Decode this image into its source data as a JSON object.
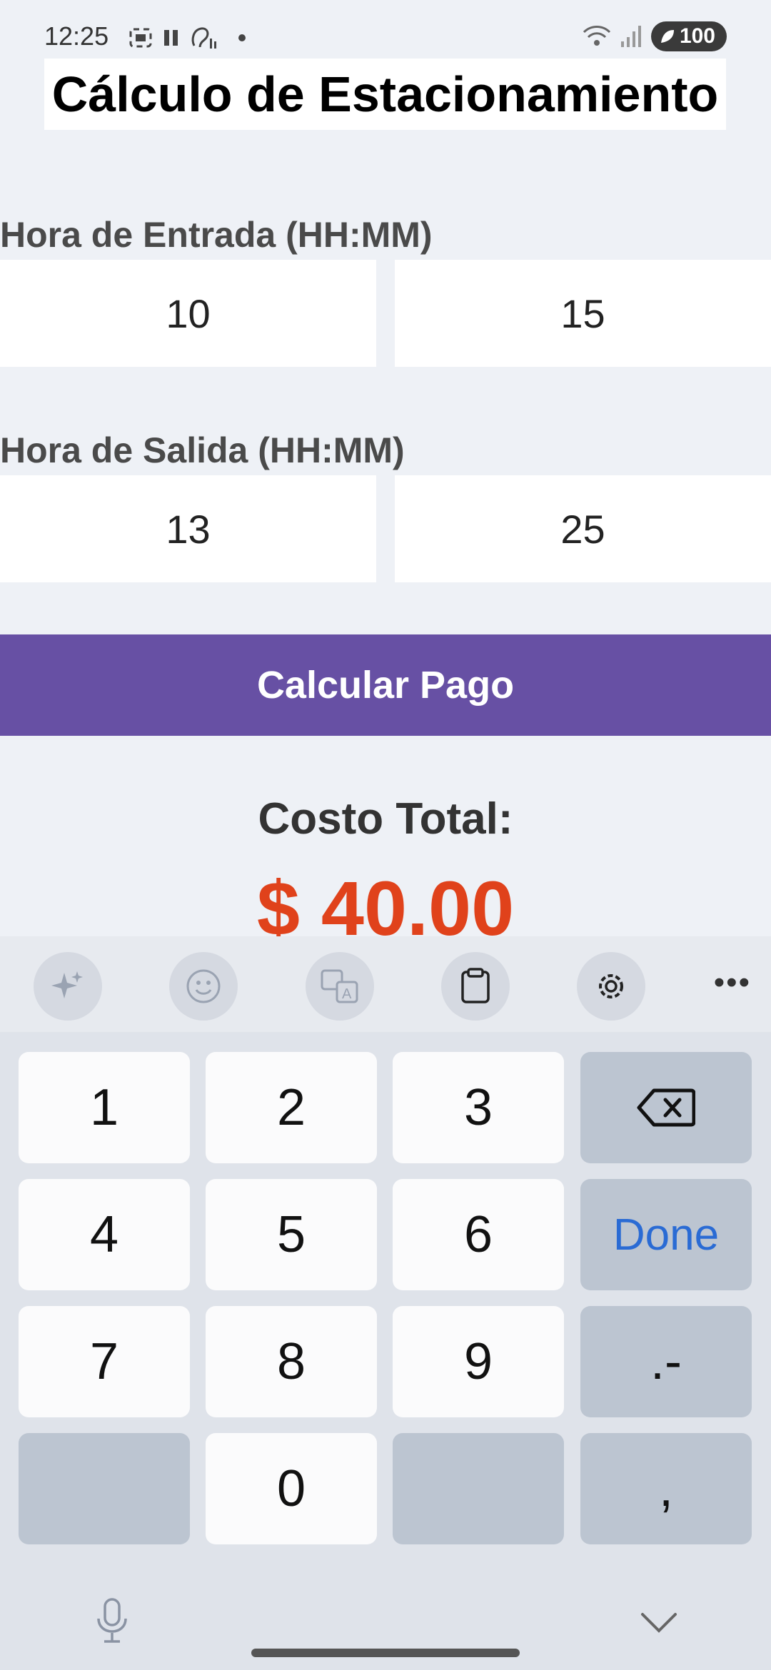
{
  "status_bar": {
    "time": "12:25",
    "battery": "100"
  },
  "app": {
    "title": "Cálculo de Estacionamiento"
  },
  "entry": {
    "label": "Hora de Entrada (HH:MM)",
    "hours": "10",
    "minutes": "15"
  },
  "exit": {
    "label": "Hora de Salida (HH:MM)",
    "hours": "13",
    "minutes": "25"
  },
  "calculate_button": "Calcular Pago",
  "result": {
    "label": "Costo Total:",
    "value": "$ 40.00"
  },
  "keyboard": {
    "toolbar_icons": [
      "sparkle-icon",
      "emoji-icon",
      "translate-icon",
      "clipboard-icon",
      "settings-icon",
      "more-icon"
    ],
    "keys": {
      "k1": "1",
      "k2": "2",
      "k3": "3",
      "k4": "4",
      "k5": "5",
      "k6": "6",
      "k7": "7",
      "k8": "8",
      "k9": "9",
      "k0": "0",
      "done": "Done",
      "dot_dash": ".-",
      "comma": ","
    }
  },
  "colors": {
    "accent": "#6750a4",
    "cost": "#e0421b",
    "done_key": "#2a6bd4"
  }
}
